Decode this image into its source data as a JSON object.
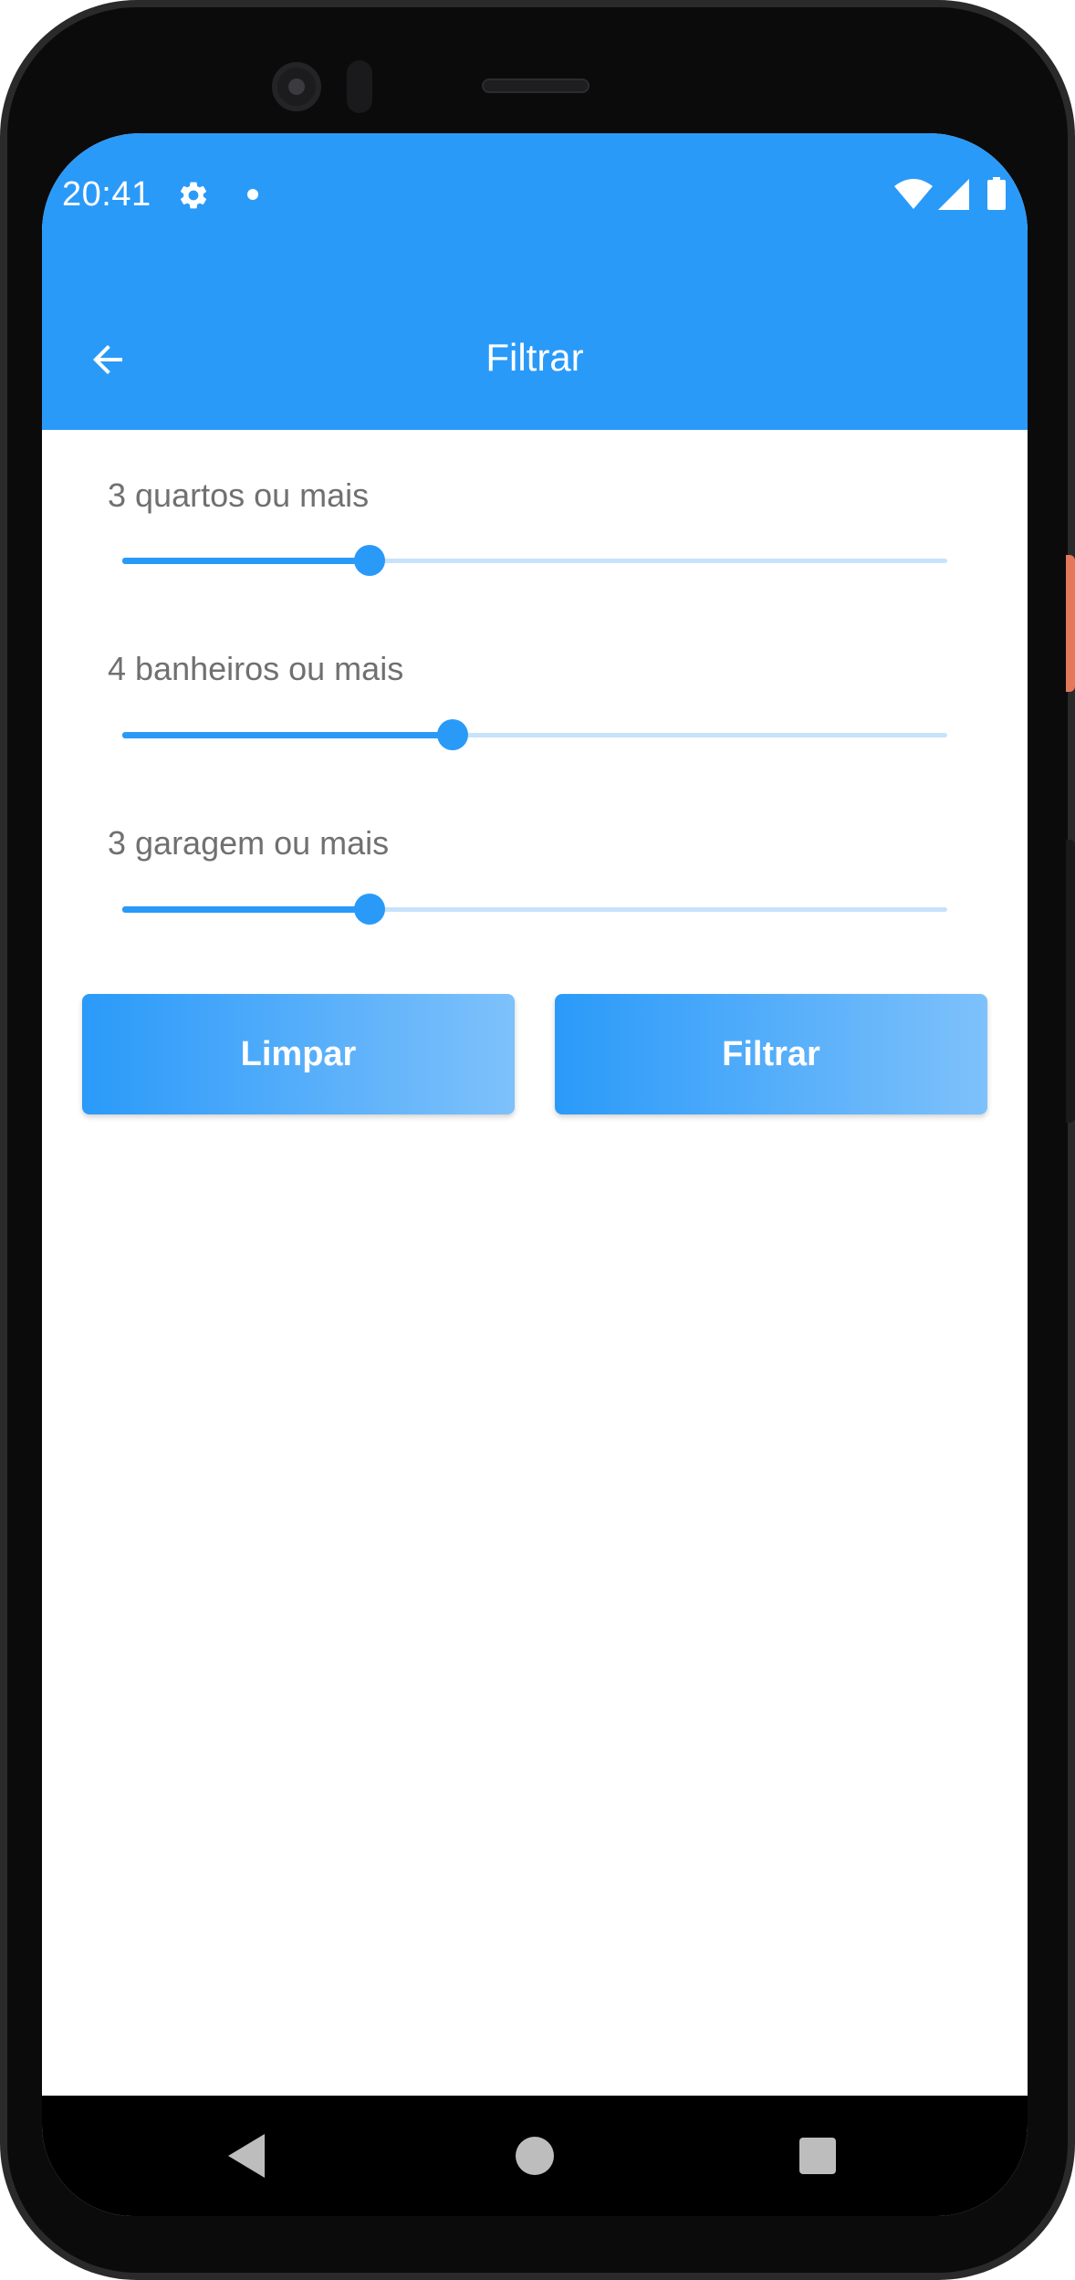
{
  "status_bar": {
    "time": "20:41",
    "icons": [
      "gear-icon",
      "notification-dot",
      "wifi-icon",
      "signal-icon",
      "battery-icon"
    ]
  },
  "app_bar": {
    "title": "Filtrar",
    "back_icon": "arrow-left-icon"
  },
  "filters": [
    {
      "label": "3 quartos ou mais",
      "value_fraction": 0.3
    },
    {
      "label": "4 banheiros ou mais",
      "value_fraction": 0.4
    },
    {
      "label": "3 garagem ou mais",
      "value_fraction": 0.3
    }
  ],
  "buttons": {
    "clear_label": "Limpar",
    "filter_label": "Filtrar"
  },
  "nav_bar": {
    "icons": [
      "nav-back-icon",
      "nav-home-icon",
      "nav-recents-icon"
    ]
  },
  "colors": {
    "primary": "#2a9af9",
    "primary_light": "#7ec1fb",
    "track_inactive": "#c7e3fc",
    "label_text": "#707070"
  }
}
